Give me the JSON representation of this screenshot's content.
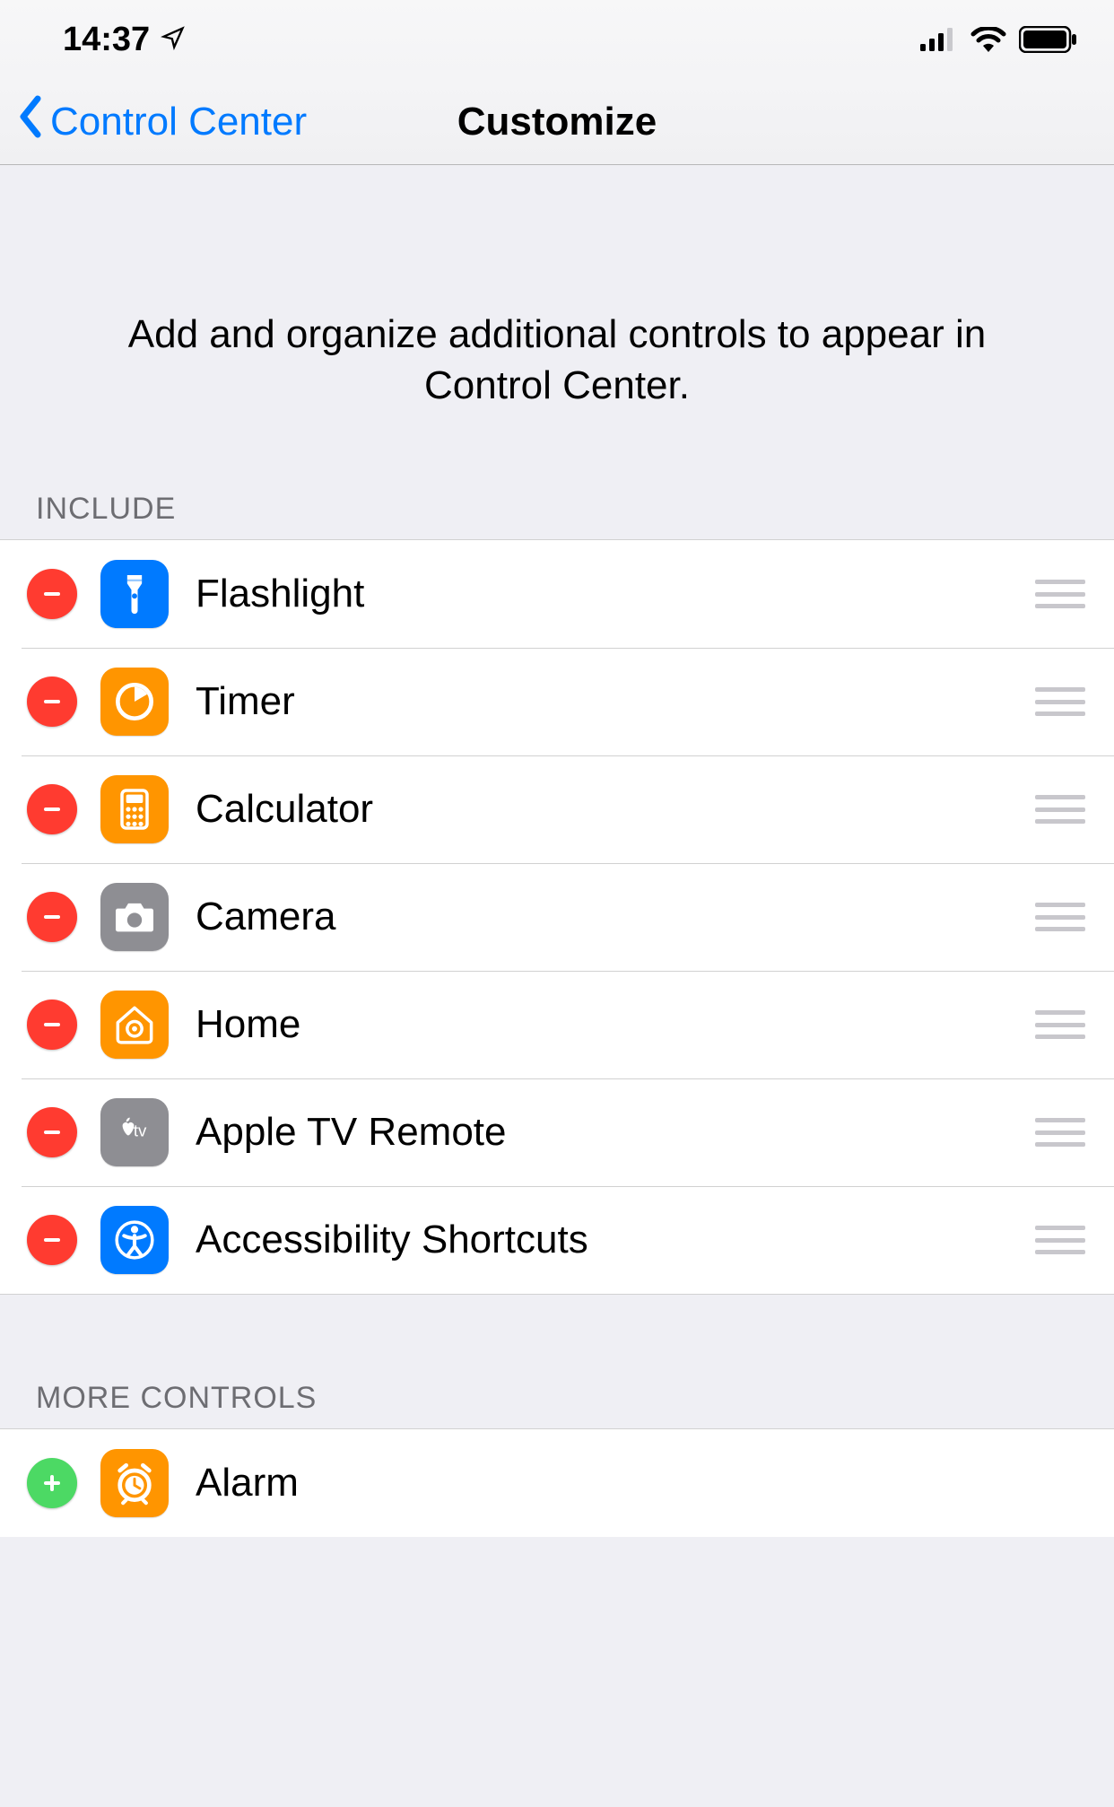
{
  "status": {
    "time": "14:37"
  },
  "nav": {
    "back_label": "Control Center",
    "title": "Customize"
  },
  "intro": "Add and organize additional controls to appear in Control Center.",
  "sections": {
    "include_header": "Include",
    "include": [
      {
        "label": "Flashlight",
        "icon": "flashlight",
        "bg": "#007aff"
      },
      {
        "label": "Timer",
        "icon": "timer",
        "bg": "#ff9500"
      },
      {
        "label": "Calculator",
        "icon": "calculator",
        "bg": "#ff9500"
      },
      {
        "label": "Camera",
        "icon": "camera",
        "bg": "#8e8e93"
      },
      {
        "label": "Home",
        "icon": "home",
        "bg": "#ff9500"
      },
      {
        "label": "Apple TV Remote",
        "icon": "appletv",
        "bg": "#8e8e93"
      },
      {
        "label": "Accessibility Shortcuts",
        "icon": "accessibility",
        "bg": "#007aff"
      }
    ],
    "more_header": "More Controls",
    "more": [
      {
        "label": "Alarm",
        "icon": "alarm",
        "bg": "#ff9500"
      }
    ]
  }
}
